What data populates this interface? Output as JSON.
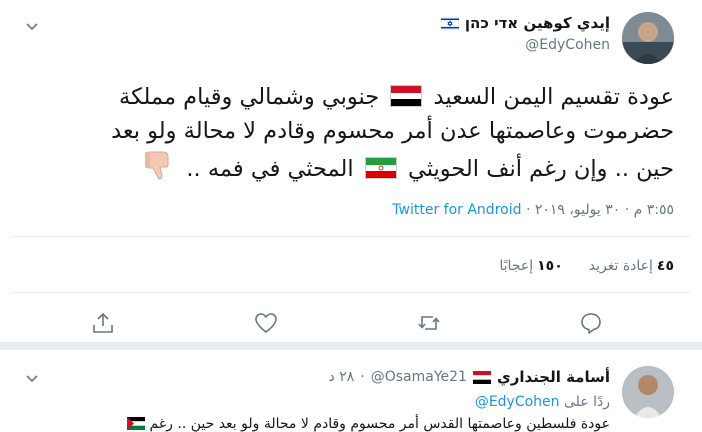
{
  "main_tweet": {
    "display_name": "إيدي كوهين אדי כהן",
    "handle": "@EdyCohen",
    "text_line1_a": "عودة تقسيم اليمن السعيد",
    "text_line1_b": "جنوبي وشمالي وقيام مملكة",
    "text_line2": "حضرموت وعاصمتها عدن أمر محسوم وقادم لا محالة ولو بعد",
    "text_line3_a": "حين .. وإن رغم أنف الحويثي",
    "text_line3_b": "المحثي في فمه ..",
    "timestamp": "٣:٥٥ م · ٣٠ يوليو، ٢٠١٩ ·",
    "source": "Twitter for Android",
    "retweets_count": "٤٥",
    "retweets_label": "إعادة تغريد",
    "likes_count": "١٥٠",
    "likes_label": "إعجابًا"
  },
  "reply": {
    "display_name": "أسامة الجنداري",
    "handle": "@OsamaYe21",
    "time": "٢٨ د",
    "replying_prefix": "ردًا على",
    "replying_to": "@EdyCohen",
    "text_preview": "عودة فلسطين وعاصمتها القدس أمر محسوم وقادم لا محالة ولو بعد حين .. رغم"
  },
  "colors": {
    "accent": "#1b95e0",
    "secondary_text": "#657786",
    "border": "#e6ecf0"
  },
  "icons": [
    "israel-flag-icon",
    "yemen-flag-icon",
    "iran-flag-icon",
    "thumbs-down-icon",
    "reply-icon",
    "retweet-icon",
    "like-icon",
    "share-icon",
    "chevron-down-icon",
    "palestine-flag-icon"
  ]
}
